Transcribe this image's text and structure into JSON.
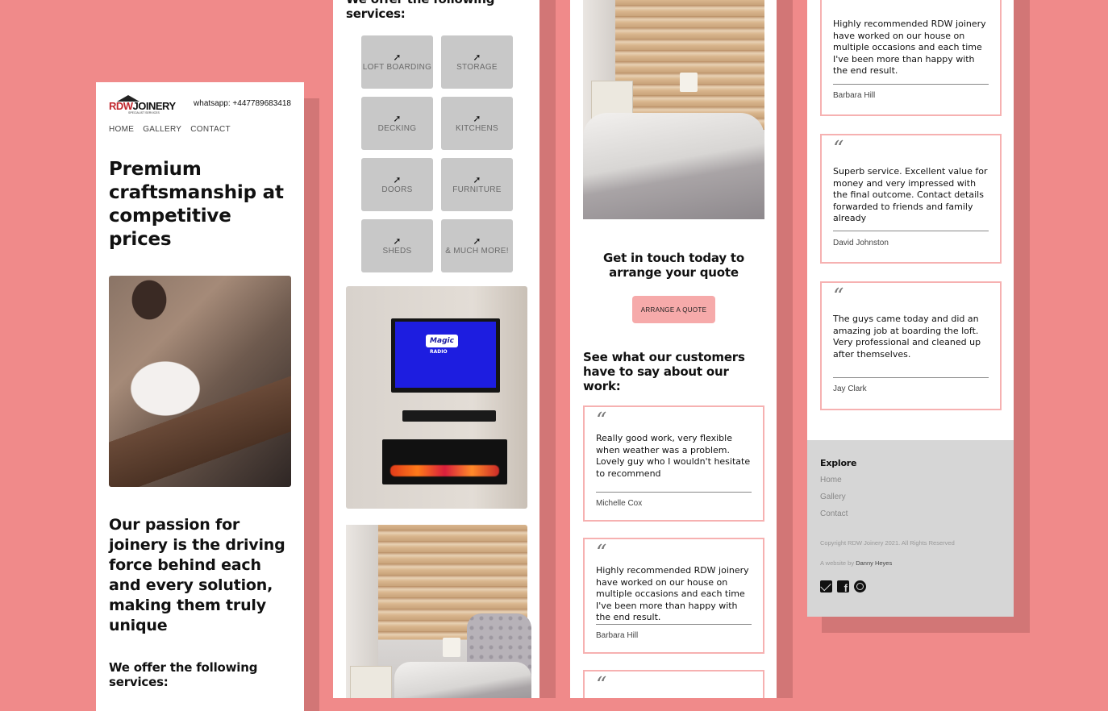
{
  "brand": {
    "logo_main": "RDW",
    "logo_second": "JOINERY",
    "logo_sub": "SPECIALIST SERVICES"
  },
  "contact": {
    "whatsapp": "whatsapp: +447789683418"
  },
  "nav": {
    "home": "HOME",
    "gallery": "GALLERY",
    "contact": "CONTACT"
  },
  "hero": {
    "title": "Premium craftsmanship at competitive prices"
  },
  "passion": {
    "text": "Our passion for joinery is the driving force behind each and every solution, making them truly unique"
  },
  "services": {
    "title": "We offer the following services:",
    "items": [
      "LOFT BOARDING",
      "STORAGE",
      "DECKING",
      "KITCHENS",
      "DOORS",
      "FURNITURE",
      "SHEDS",
      "& MUCH MORE!"
    ]
  },
  "tv_photo": {
    "brand": "Magic",
    "brand_sub": "RADIO"
  },
  "cta": {
    "title": "Get in touch today to arrange your quote",
    "button": "ARRANGE A QUOTE"
  },
  "reviews": {
    "title": "See what our customers have to say about our work:",
    "quote_mark": "“",
    "items": [
      {
        "text": "Really good work, very flexible when weather was a problem. Lovely guy who I wouldn't hesitate to recommend",
        "name": "Michelle Cox"
      },
      {
        "text": "Highly recommended RDW joinery have worked on our house on multiple occasions and each time I've been more than happy with the end result.",
        "name": "Barbara Hill"
      },
      {
        "text": "Superb service. Excellent value for money and very impressed with the final outcome. Contact details forwarded to friends and family already",
        "name": "David Johnston"
      },
      {
        "text": "The guys came today and did an amazing job at boarding the loft. Very professional and cleaned up after themselves.",
        "name": "Jay Clark"
      }
    ]
  },
  "footer": {
    "explore": "Explore",
    "links": [
      "Home",
      "Gallery",
      "Contact"
    ],
    "copyright": "Copyright RDW Joinery 2021. All Rights Reserved",
    "credit_prefix": "A website by",
    "credit_name": "Danny Heyes"
  },
  "colors": {
    "background": "#f08a8a",
    "shadow": "#d27676",
    "accent_button": "#f6aaaa",
    "review_border": "#f6b1b1",
    "footer_bg": "#d6d6d6"
  }
}
